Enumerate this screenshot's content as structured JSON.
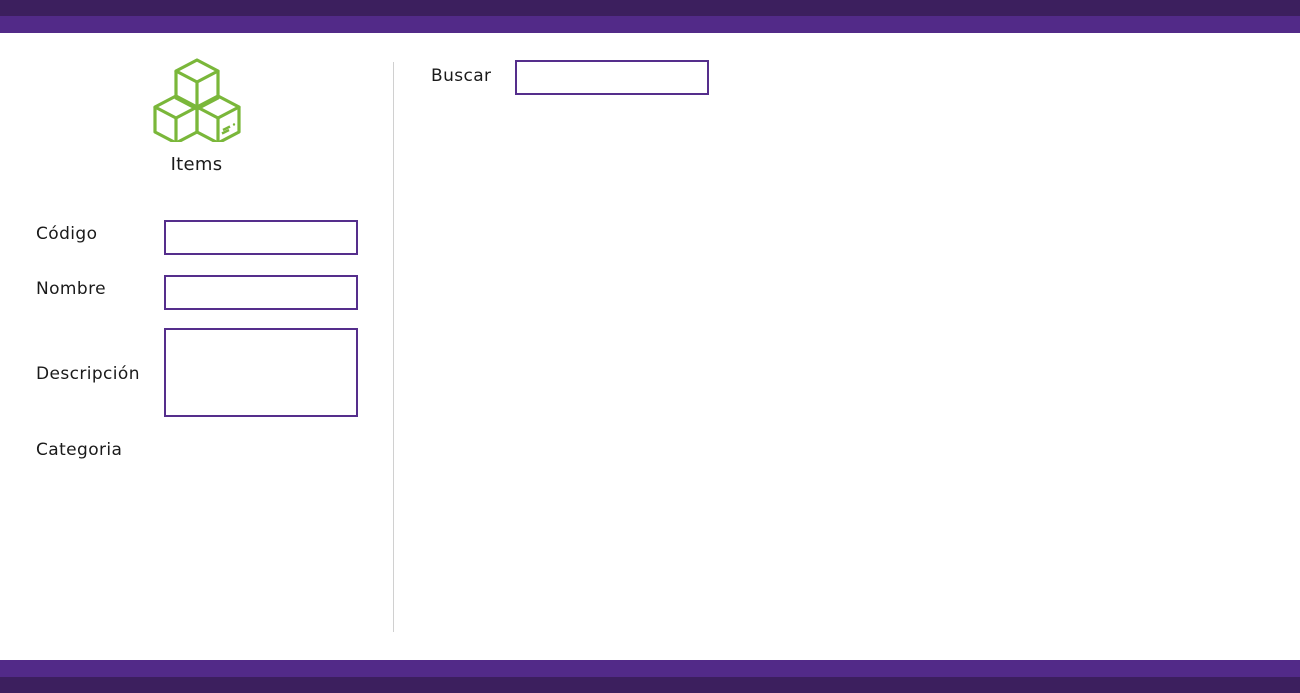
{
  "header": {
    "bar_colors": {
      "dark": "#3c1f5e",
      "light": "#522a88"
    }
  },
  "form": {
    "icon": "boxes-icon",
    "icon_color": "#7ab73a",
    "title": "Items",
    "fields": {
      "codigo": {
        "label": "Código",
        "value": ""
      },
      "nombre": {
        "label": "Nombre",
        "value": ""
      },
      "descripcion": {
        "label": "Descripción",
        "value": ""
      },
      "categoria": {
        "label": "Categoria"
      }
    }
  },
  "search": {
    "label": "Buscar",
    "value": ""
  },
  "accent_color": "#552e8c"
}
